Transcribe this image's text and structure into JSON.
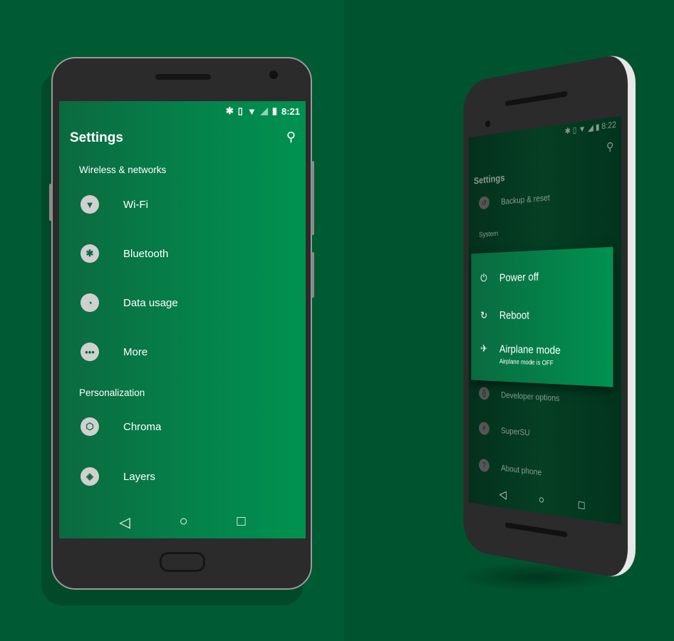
{
  "left_phone": {
    "status": {
      "time": "8:21",
      "icons": [
        "bluetooth-icon",
        "vibrate-icon",
        "wifi-icon",
        "signal-icon",
        "battery-icon"
      ]
    },
    "title": "Settings",
    "sections": [
      {
        "header": "Wireless & networks",
        "items": [
          {
            "label": "Wi-Fi",
            "icon": "wifi-icon"
          },
          {
            "label": "Bluetooth",
            "icon": "bluetooth-icon"
          },
          {
            "label": "Data usage",
            "icon": "data-usage-icon"
          },
          {
            "label": "More",
            "icon": "more-icon"
          }
        ]
      },
      {
        "header": "Personalization",
        "items": [
          {
            "label": "Chroma",
            "icon": "chroma-icon"
          },
          {
            "label": "Layers",
            "icon": "layers-icon"
          }
        ]
      }
    ]
  },
  "right_phone": {
    "status": {
      "time": "8:22"
    },
    "title": "Settings",
    "items": [
      {
        "label": "Backup & reset"
      },
      {
        "label": "Developer options"
      },
      {
        "label": "SuperSU"
      },
      {
        "label": "About phone"
      }
    ],
    "section": "System",
    "power_menu": {
      "power_off": "Power off",
      "reboot": "Reboot",
      "airplane": "Airplane mode",
      "airplane_sub": "Airplane mode is OFF"
    }
  },
  "colors": {
    "background": "#005a33",
    "accent": "#009150"
  }
}
